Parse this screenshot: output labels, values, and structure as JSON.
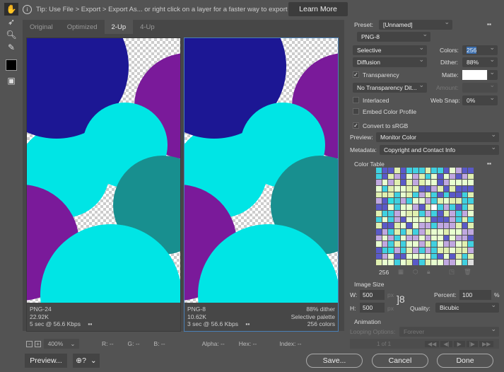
{
  "toolbar": {
    "tools": [
      "hand-icon",
      "eyedropper-slice-icon",
      "zoom-icon",
      "eyedropper-icon"
    ],
    "swatch_color": "#000000"
  },
  "tip": {
    "text": "Tip: Use File > Export > Export As...  or right click on a layer for a faster way to export assets",
    "button": "Learn More"
  },
  "tabs": [
    "Original",
    "Optimized",
    "2-Up",
    "4-Up"
  ],
  "active_tab": "2-Up",
  "panes": [
    {
      "format": "PNG-24",
      "size": "22.92K",
      "time": "5 sec @ 56.6 Kbps",
      "right": []
    },
    {
      "format": "PNG-8",
      "size": "10.62K",
      "time": "3 sec @ 56.6 Kbps",
      "right": [
        "88% dither",
        "Selective palette",
        "256 colors"
      ]
    }
  ],
  "status": {
    "zoom": "400%",
    "r": "R: --",
    "g": "G: --",
    "b": "B: --",
    "alpha": "Alpha: --",
    "hex": "Hex: --",
    "index": "Index: --"
  },
  "bottom": {
    "preview": "Preview...",
    "save": "Save...",
    "cancel": "Cancel",
    "done": "Done"
  },
  "settings": {
    "preset_label": "Preset:",
    "preset": "[Unnamed]",
    "format": "PNG-8",
    "reduction": "Selective",
    "colors_label": "Colors:",
    "colors": "256",
    "dither_algo": "Diffusion",
    "dither_label": "Dither:",
    "dither": "88%",
    "transparency": {
      "label": "Transparency",
      "checked": true
    },
    "matte_label": "Matte:",
    "matte_color": "#ffffff",
    "transparency_dither": "No Transparency Dit...",
    "amount_label": "Amount:",
    "interlaced": {
      "label": "Interlaced",
      "checked": false
    },
    "websnap_label": "Web Snap:",
    "websnap": "0%",
    "embed": {
      "label": "Embed Color Profile",
      "checked": false
    },
    "srgb": {
      "label": "Convert to sRGB",
      "checked": true
    },
    "preview_label": "Preview:",
    "preview": "Monitor Color",
    "metadata_label": "Metadata:",
    "metadata": "Copyright and Contact Info"
  },
  "color_table": {
    "title": "Color Table",
    "count": "256",
    "palette": [
      "#5a5ac8",
      "#ffffff",
      "#d8b8e8",
      "#1aa3a3",
      "#c0a8e0",
      "#8a8ad8",
      "#b070d0",
      "#9ad020",
      "#e8ffd0",
      "#00c8d8",
      "#2020a0",
      "#a0e020",
      "#e0f0b0",
      "#30e0e0",
      "#7a2090",
      "#30a0a0",
      "#40d0e0",
      "#b0f0f0",
      "#e8e8ff",
      "#20d0d0"
    ]
  },
  "image_size": {
    "title": "Image Size",
    "w_label": "W:",
    "w": "500",
    "h_label": "H:",
    "h": "500",
    "unit": "px",
    "percent_label": "Percent:",
    "percent": "100",
    "percent_unit": "%",
    "quality_label": "Quality:",
    "quality": "Bicubic"
  },
  "animation": {
    "title": "Animation",
    "looping_label": "Looping Options:",
    "looping": "Forever",
    "frame": "1 of 1"
  }
}
